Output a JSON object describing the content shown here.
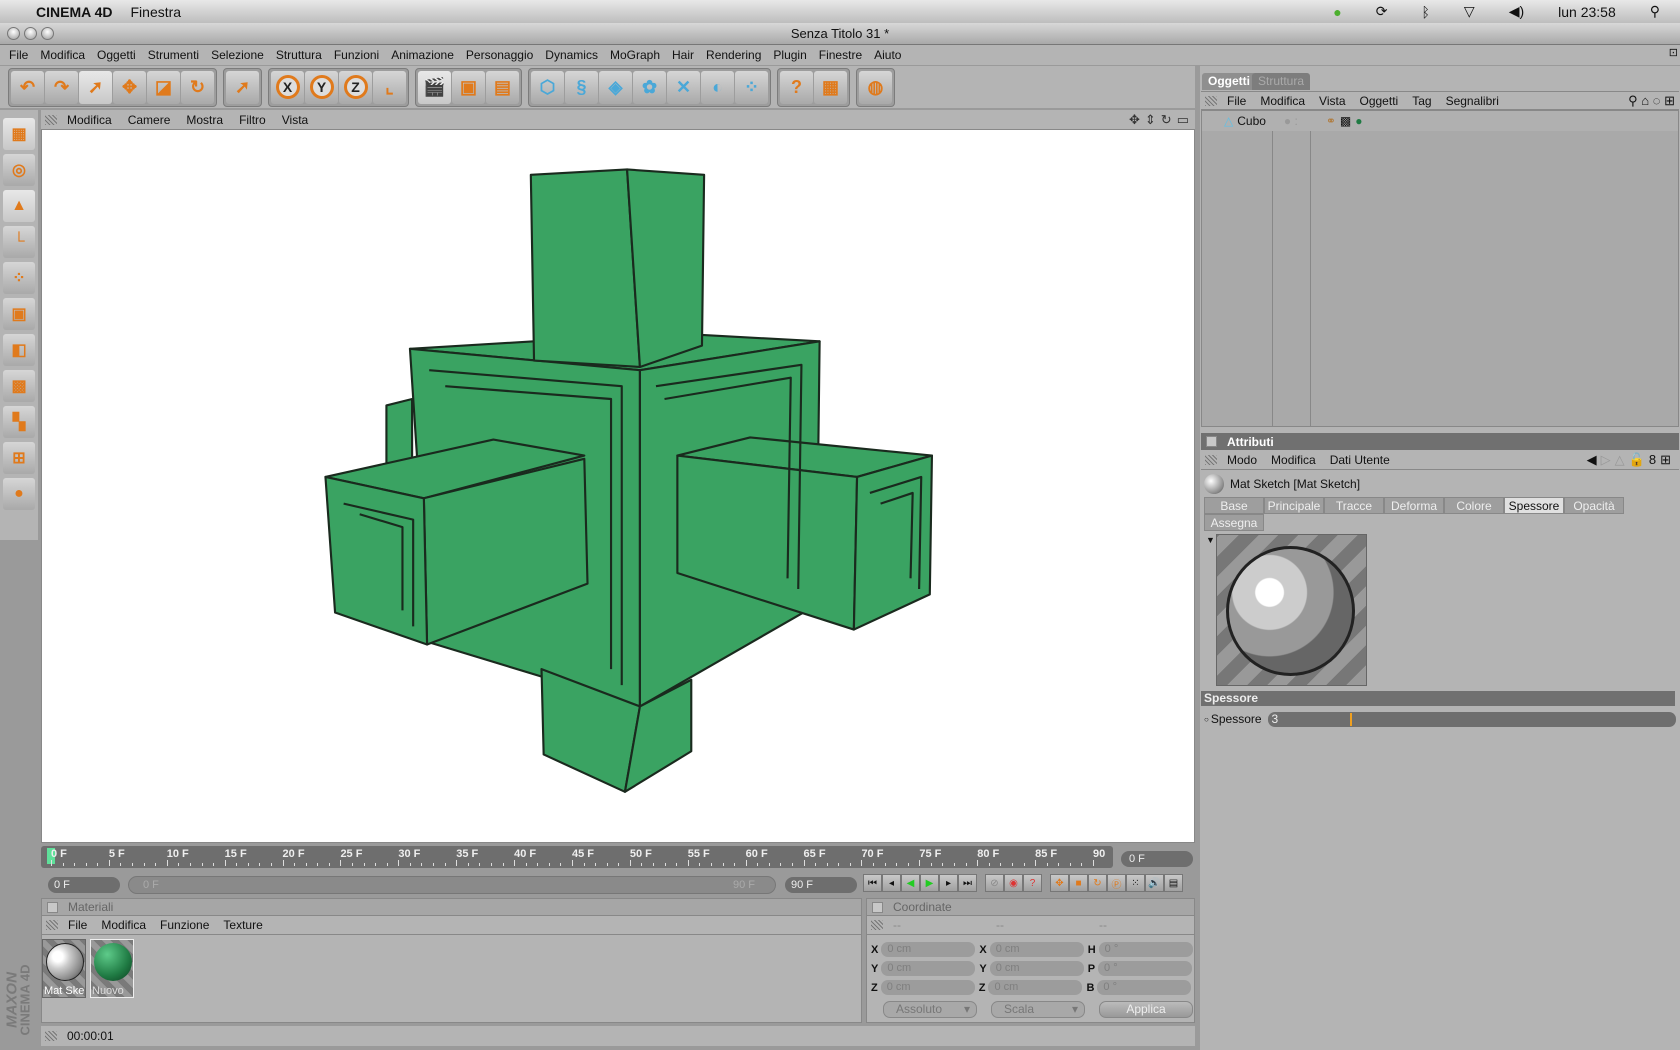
{
  "mac_menubar": {
    "app": "CINEMA 4D",
    "menu": "Finestra",
    "clock": "lun 23:58"
  },
  "window": {
    "title": "Senza Titolo 31 *"
  },
  "app_menu": [
    "File",
    "Modifica",
    "Oggetti",
    "Strumenti",
    "Selezione",
    "Struttura",
    "Funzioni",
    "Animazione",
    "Personaggio",
    "Dynamics",
    "MoGraph",
    "Hair",
    "Rendering",
    "Plugin",
    "Finestre",
    "Aiuto"
  ],
  "toolbar": {
    "groups": [
      [
        "undo-icon",
        "redo-icon",
        "live-select-icon",
        "move-icon",
        "scale-icon",
        "rotate-icon"
      ],
      [
        "select-icon"
      ],
      [
        "x-axis-icon",
        "y-axis-icon",
        "z-axis-icon",
        "world-coord-icon"
      ],
      [
        "render-view-icon",
        "render-picture-icon",
        "render-settings-icon"
      ],
      [
        "cube-primitive-icon",
        "spline-icon",
        "nurbs-icon",
        "array-icon",
        "deformer-icon",
        "scene-icon",
        "particle-icon"
      ],
      [
        "help-icon",
        "table-help-icon"
      ],
      [
        "web-icon"
      ]
    ],
    "x_label": "X",
    "y_label": "Y",
    "z_label": "Z"
  },
  "viewport": {
    "menu": [
      "Modifica",
      "Camere",
      "Mostra",
      "Filtro",
      "Vista"
    ],
    "object_color": "#3aa362"
  },
  "timeline": {
    "ticks": [
      "0 F",
      "5 F",
      "10 F",
      "15 F",
      "20 F",
      "25 F",
      "30 F",
      "35 F",
      "40 F",
      "45 F",
      "50 F",
      "55 F",
      "60 F",
      "65 F",
      "70 F",
      "75 F",
      "80 F",
      "85 F",
      "90"
    ],
    "current_frame": "0 F",
    "start": "0 F",
    "range_start": "0 F",
    "range_end": "90 F",
    "end": "90 F"
  },
  "materials": {
    "title": "Materiali",
    "menu": [
      "File",
      "Modifica",
      "Funzione",
      "Texture"
    ],
    "items": [
      {
        "name": "Mat Ske"
      },
      {
        "name": "Nuovo"
      }
    ]
  },
  "coordinates": {
    "title": "Coordinate",
    "columns": [
      "--",
      "--",
      "--"
    ],
    "rows": [
      [
        "X",
        "0 cm",
        "X",
        "0 cm",
        "H",
        "0 °"
      ],
      [
        "Y",
        "0 cm",
        "Y",
        "0 cm",
        "P",
        "0 °"
      ],
      [
        "Z",
        "0 cm",
        "Z",
        "0 cm",
        "B",
        "0 °"
      ]
    ],
    "mode": "Assoluto",
    "type": "Scala",
    "apply": "Applica"
  },
  "status": {
    "time": "00:00:01"
  },
  "logo": {
    "line1": "MAXON",
    "line2": "CINEMA 4D"
  },
  "objects": {
    "tabs": [
      "Oggetti",
      "Struttura"
    ],
    "menu": [
      "File",
      "Modifica",
      "Vista",
      "Oggetti",
      "Tag",
      "Segnalibri"
    ],
    "items": [
      {
        "name": "Cubo"
      }
    ]
  },
  "attributes": {
    "title": "Attributi",
    "menu": [
      "Modo",
      "Modifica",
      "Dati Utente"
    ],
    "material": "Mat Sketch [Mat Sketch]",
    "tabs": [
      "Base",
      "Principale",
      "Tracce",
      "Deforma",
      "Colore",
      "Spessore",
      "Opacità",
      "Assegna"
    ],
    "active_tab": "Spessore",
    "section": "Spessore",
    "param_label": "Spessore",
    "param_value": "3"
  }
}
